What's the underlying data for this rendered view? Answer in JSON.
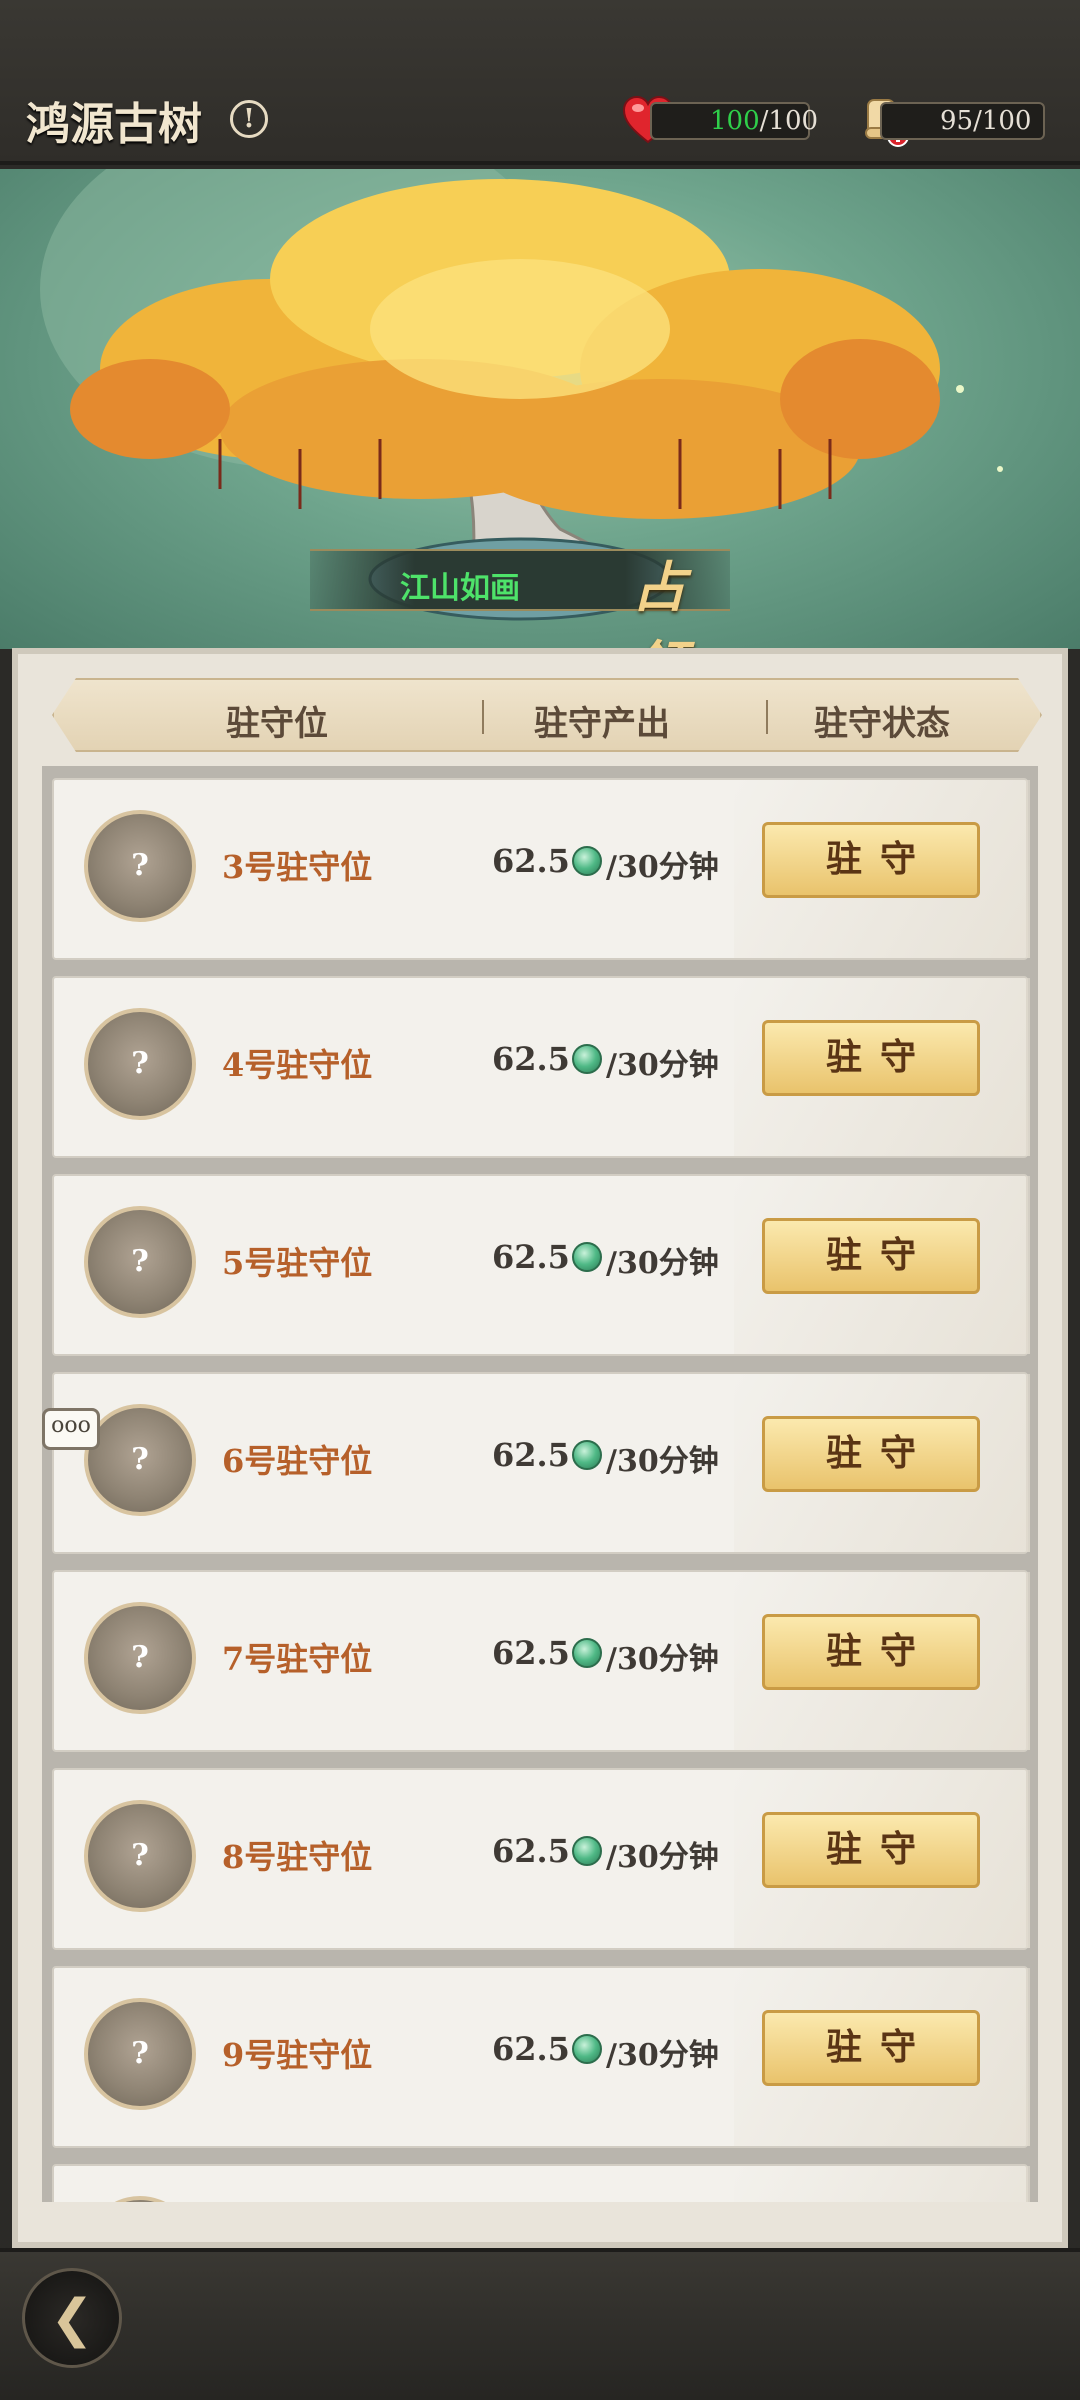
{
  "topbar": {
    "title": "鸿源古树",
    "info_icon": "!",
    "hp": {
      "current": "100",
      "max": "/100"
    },
    "scroll": {
      "value": "95/100"
    }
  },
  "hero": {
    "occupant": "江山如画",
    "occupy_label": "占领"
  },
  "table": {
    "headers": [
      "驻守位",
      "驻守产出",
      "驻守状态"
    ],
    "rows": [
      {
        "slot": "3号驻守位",
        "amount": "62.5",
        "per": "/30分钟",
        "button": "驻守",
        "avatar": "?"
      },
      {
        "slot": "4号驻守位",
        "amount": "62.5",
        "per": "/30分钟",
        "button": "驻守",
        "avatar": "?"
      },
      {
        "slot": "5号驻守位",
        "amount": "62.5",
        "per": "/30分钟",
        "button": "驻守",
        "avatar": "?"
      },
      {
        "slot": "6号驻守位",
        "amount": "62.5",
        "per": "/30分钟",
        "button": "驻守",
        "avatar": "?"
      },
      {
        "slot": "7号驻守位",
        "amount": "62.5",
        "per": "/30分钟",
        "button": "驻守",
        "avatar": "?"
      },
      {
        "slot": "8号驻守位",
        "amount": "62.5",
        "per": "/30分钟",
        "button": "驻守",
        "avatar": "?"
      },
      {
        "slot": "9号驻守位",
        "amount": "62.5",
        "per": "/30分钟",
        "button": "驻守",
        "avatar": "?"
      }
    ]
  },
  "chat": {
    "dots": "ooo"
  },
  "nav": {
    "back": "❮"
  },
  "colors": {
    "accent_gold": "#e9c36c",
    "slot_text": "#b6602a",
    "hp_green": "#2fcf4a"
  },
  "icons": [
    "info-icon",
    "heart-icon",
    "scroll-icon",
    "jade-coin-icon",
    "chat-bubble-icon",
    "back-icon"
  ]
}
